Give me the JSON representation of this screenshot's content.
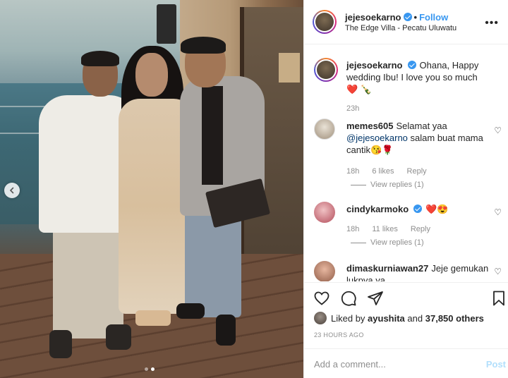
{
  "post": {
    "username": "jejesoekarno",
    "follow_label": "Follow",
    "separator": "•",
    "location": "The Edge Villa - Pecatu Uluwatu",
    "more_icon": "•••",
    "carousel": {
      "total": 2,
      "active": 2
    }
  },
  "caption": {
    "username": "jejesoekarno",
    "text": "Ohana, Happy wedding Ibu! I love you so much ❤️ 🍾",
    "time": "23h"
  },
  "comments": [
    {
      "username": "memes605",
      "text_before": "Selamat yaa ",
      "mention": "@jejesoekarno",
      "text_after": " salam buat mama cantik😘🌹",
      "time": "18h",
      "likes": "6 likes",
      "reply": "Reply",
      "view_replies": "View replies (1)"
    },
    {
      "username": "cindykarmoko",
      "text": "❤️😍",
      "time": "18h",
      "likes": "11 likes",
      "reply": "Reply",
      "view_replies": "View replies (1)"
    },
    {
      "username": "dimaskurniawan27",
      "text": "Jeje gemukan lukpya ya"
    }
  ],
  "likes": {
    "prefix": "Liked by ",
    "user": "ayushita",
    "middle": " and ",
    "count": "37,850 others"
  },
  "timestamp": "23 HOURS AGO",
  "add_comment": {
    "placeholder": "Add a comment...",
    "post_label": "Post"
  },
  "colors": {
    "link": "#3897f0",
    "muted": "#8e8e8e",
    "post_disabled": "#b2dffc"
  },
  "icons": [
    "more-icon",
    "verified-badge-icon",
    "heart-icon",
    "comment-icon",
    "share-icon",
    "bookmark-icon",
    "chevron-left-icon"
  ]
}
